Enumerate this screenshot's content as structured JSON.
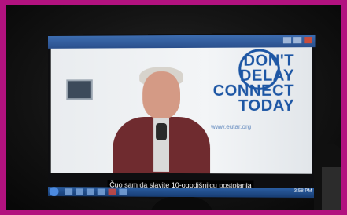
{
  "video": {
    "logo_lines": [
      "DON'T",
      "DELAY",
      "CONNECT",
      "TODAY"
    ],
    "logo_url": "www.eutar.org",
    "subtitle": "Čuo sam da slavite 10-ogodišnjicu postojanja"
  },
  "taskbar": {
    "clock": "3:58 PM"
  },
  "colors": {
    "frame": "#b2127f",
    "logo": "#1d56a4",
    "jacket": "#6f2b2f"
  }
}
